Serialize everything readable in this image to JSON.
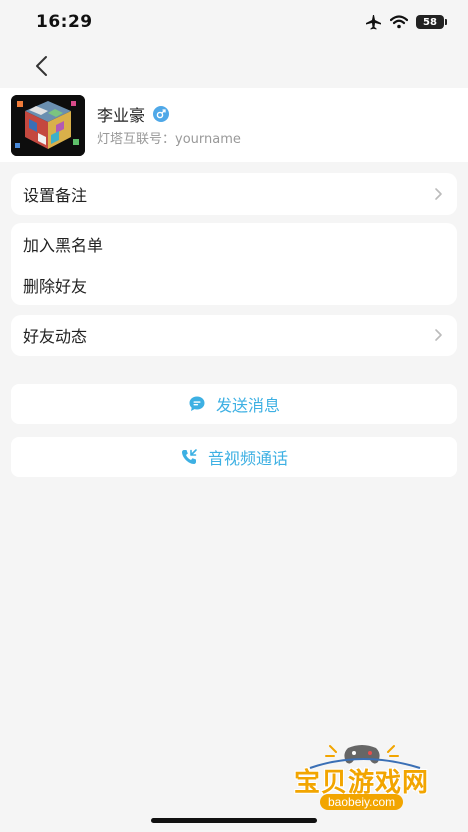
{
  "status_bar": {
    "time": "16:29",
    "battery": "58"
  },
  "profile": {
    "name": "李业豪",
    "id_line": "灯塔互联号：yourname"
  },
  "settings": {
    "remark": "设置备注",
    "blacklist": "加入黑名单",
    "delete_friend": "删除好友",
    "friend_moments": "好友动态"
  },
  "actions": {
    "send_message": "发送消息",
    "av_call": "音视频通话"
  },
  "watermark": {
    "text": "宝贝游戏网",
    "url": "baobeiy.com"
  },
  "colors": {
    "accent": "#3db0e3",
    "background": "#f5f5f5",
    "watermark": "#f2a500"
  }
}
